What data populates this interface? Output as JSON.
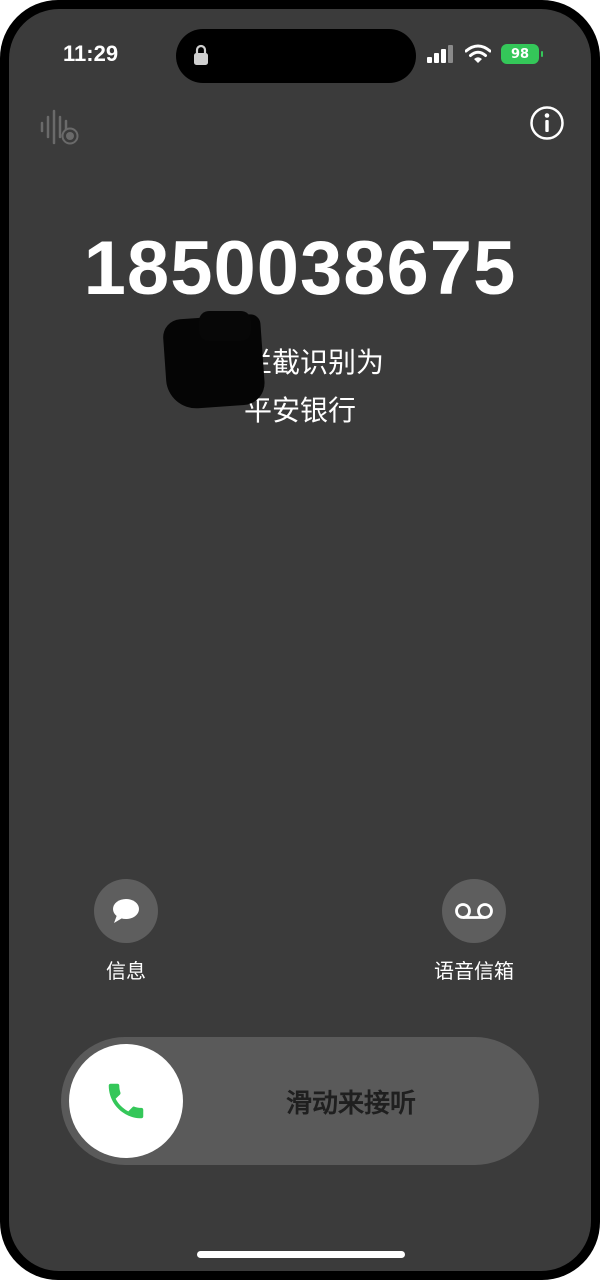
{
  "status_bar": {
    "time": "11:29",
    "battery": "98"
  },
  "caller": {
    "number": "1850038675",
    "line1": "拦截识别为",
    "line2": "平安银行"
  },
  "actions": {
    "message_label": "信息",
    "voicemail_label": "语音信箱"
  },
  "slider": {
    "label": "滑动来接听"
  },
  "colors": {
    "background": "#3b3b3b",
    "button": "#5e5e5e",
    "accept_green": "#34c759",
    "battery_green": "#34c759"
  },
  "icons": {
    "lock": "lock-icon",
    "signal": "signal-icon",
    "wifi": "wifi-icon",
    "battery": "battery-icon",
    "live_voicemail": "live-voicemail-icon",
    "info": "info-icon",
    "message": "message-bubble-icon",
    "voicemail": "voicemail-icon",
    "phone": "phone-icon"
  }
}
